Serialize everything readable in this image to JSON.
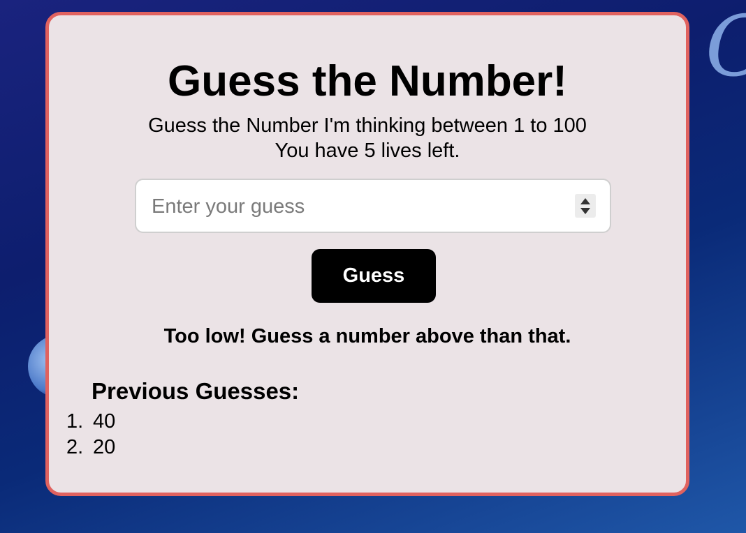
{
  "background": {
    "glyph": "O",
    "colors": {
      "top": "#1a237e",
      "bottom": "#1f57a8"
    }
  },
  "card": {
    "background": "#ebe3e6",
    "border_color": "#e0625f"
  },
  "title": "Guess the Number!",
  "subtitle": {
    "line1": "Guess the Number I'm thinking between 1 to 100",
    "line2": "You have 5 lives left."
  },
  "guess_input": {
    "value": "",
    "placeholder": "Enter your guess"
  },
  "guess_button": {
    "label": "Guess",
    "color": "#000000"
  },
  "feedback": "Too low! Guess a number above than that.",
  "previous_guesses": {
    "heading": "Previous Guesses:",
    "items": [
      {
        "index": "1.",
        "value": "40"
      },
      {
        "index": "2.",
        "value": "20"
      }
    ]
  }
}
